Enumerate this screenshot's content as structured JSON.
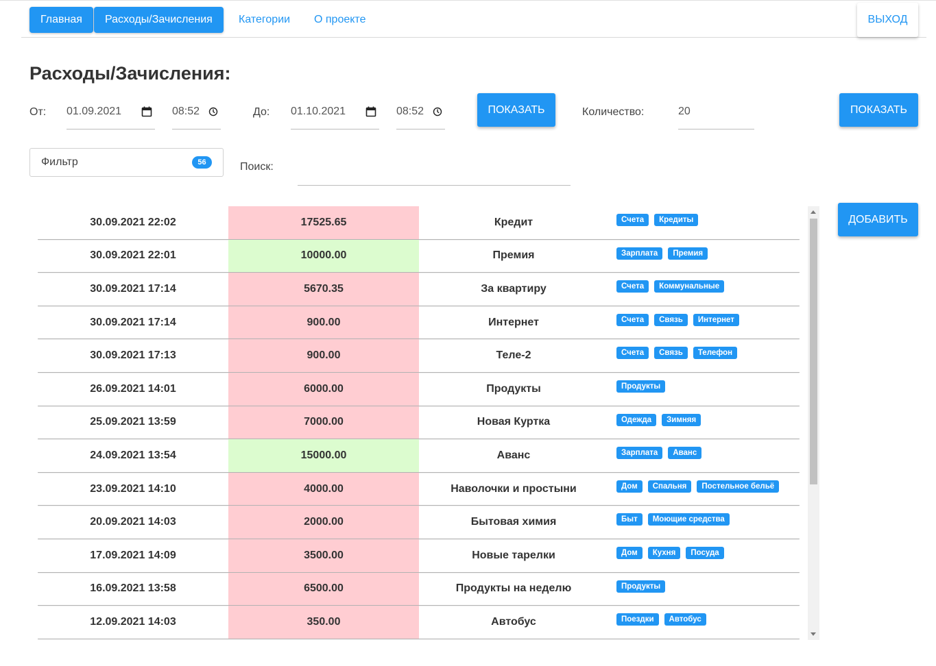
{
  "nav": {
    "items": [
      {
        "label": "Главная",
        "active": true
      },
      {
        "label": "Расходы/Зачисления",
        "active": true
      },
      {
        "label": "Категории",
        "active": false
      },
      {
        "label": "О проекте",
        "active": false
      }
    ],
    "logout_label": "Выход"
  },
  "page_title": "Расходы/Зачисления:",
  "period": {
    "from_label": "От:",
    "from_date": "01.09.2021",
    "from_time": "08:52",
    "to_label": "До:",
    "to_date": "01.10.2021",
    "to_time": "08:52",
    "show_label": "Показать"
  },
  "count": {
    "label": "Количество:",
    "value": "20",
    "show_label": "Показать"
  },
  "filter": {
    "label": "Фильтр",
    "badge": "56"
  },
  "search": {
    "label": "Поиск:",
    "value": ""
  },
  "add_label": "Добавить",
  "colors": {
    "accent": "#2196f3",
    "expense": "#ffcdd2",
    "income": "#dcfccf"
  },
  "transactions": [
    {
      "date": "30.09.2021 22:02",
      "amount": "17525.65",
      "type": "expense",
      "name": "Кредит",
      "tags": [
        "Счета",
        "Кредиты"
      ]
    },
    {
      "date": "30.09.2021 22:01",
      "amount": "10000.00",
      "type": "income",
      "name": "Премия",
      "tags": [
        "Зарплата",
        "Премия"
      ]
    },
    {
      "date": "30.09.2021 17:14",
      "amount": "5670.35",
      "type": "expense",
      "name": "За квартиру",
      "tags": [
        "Счета",
        "Коммунальные"
      ]
    },
    {
      "date": "30.09.2021 17:14",
      "amount": "900.00",
      "type": "expense",
      "name": "Интернет",
      "tags": [
        "Счета",
        "Связь",
        "Интернет"
      ]
    },
    {
      "date": "30.09.2021 17:13",
      "amount": "900.00",
      "type": "expense",
      "name": "Теле-2",
      "tags": [
        "Счета",
        "Связь",
        "Телефон"
      ]
    },
    {
      "date": "26.09.2021 14:01",
      "amount": "6000.00",
      "type": "expense",
      "name": "Продукты",
      "tags": [
        "Продукты"
      ]
    },
    {
      "date": "25.09.2021 13:59",
      "amount": "7000.00",
      "type": "expense",
      "name": "Новая Куртка",
      "tags": [
        "Одежда",
        "Зимняя"
      ]
    },
    {
      "date": "24.09.2021 13:54",
      "amount": "15000.00",
      "type": "income",
      "name": "Аванс",
      "tags": [
        "Зарплата",
        "Аванс"
      ]
    },
    {
      "date": "23.09.2021 14:10",
      "amount": "4000.00",
      "type": "expense",
      "name": "Наволочки и простыни",
      "tags": [
        "Дом",
        "Спальня",
        "Постельное бельё"
      ]
    },
    {
      "date": "20.09.2021 14:03",
      "amount": "2000.00",
      "type": "expense",
      "name": "Бытовая химия",
      "tags": [
        "Быт",
        "Моющие средства"
      ]
    },
    {
      "date": "17.09.2021 14:09",
      "amount": "3500.00",
      "type": "expense",
      "name": "Новые тарелки",
      "tags": [
        "Дом",
        "Кухня",
        "Посуда"
      ]
    },
    {
      "date": "16.09.2021 13:58",
      "amount": "6500.00",
      "type": "expense",
      "name": "Продукты на неделю",
      "tags": [
        "Продукты"
      ]
    },
    {
      "date": "12.09.2021 14:03",
      "amount": "350.00",
      "type": "expense",
      "name": "Автобус",
      "tags": [
        "Поездки",
        "Автобус"
      ]
    }
  ]
}
